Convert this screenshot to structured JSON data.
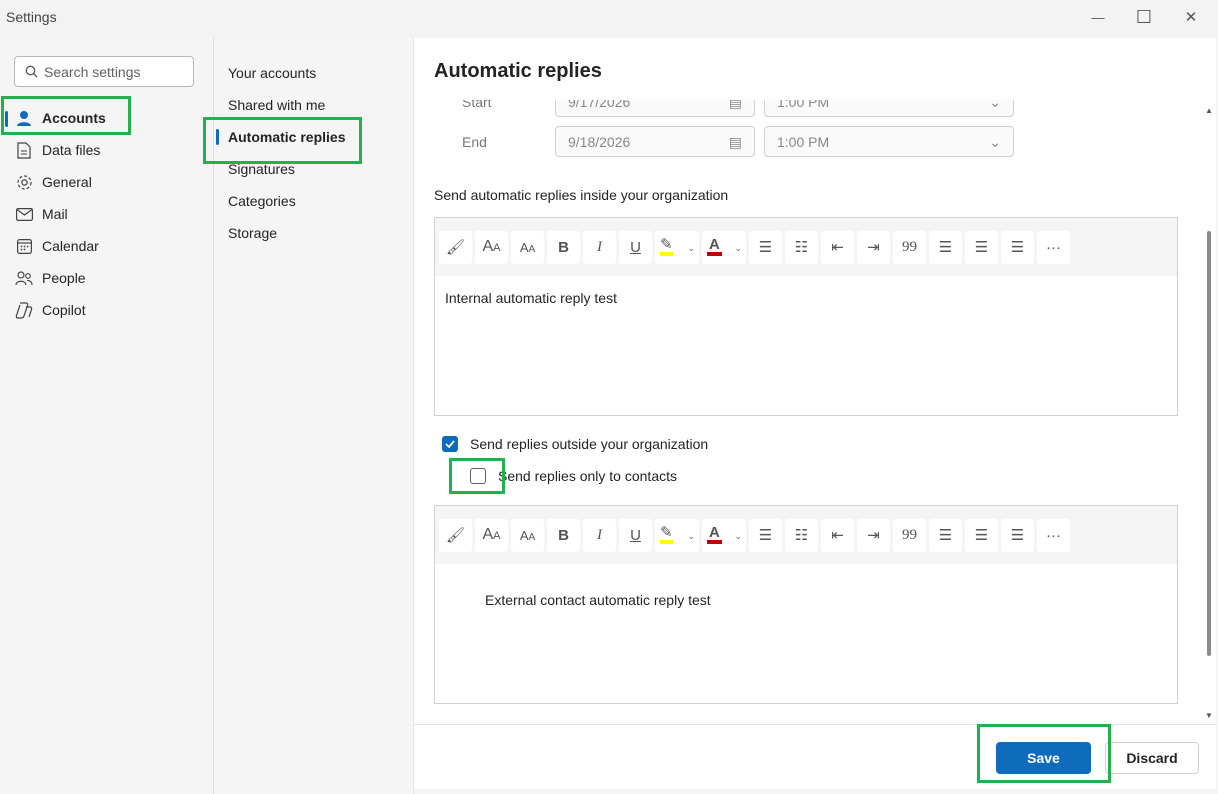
{
  "window": {
    "title": "Settings",
    "minimize_glyph": "—",
    "maximize_glyph": "☐",
    "close_glyph": "✕"
  },
  "search": {
    "placeholder": "Search settings"
  },
  "left_nav": {
    "items": [
      {
        "label": "Accounts",
        "icon": "person-icon",
        "active": true
      },
      {
        "label": "Data files",
        "icon": "document-icon"
      },
      {
        "label": "General",
        "icon": "gear-icon"
      },
      {
        "label": "Mail",
        "icon": "mail-icon"
      },
      {
        "label": "Calendar",
        "icon": "calendar-icon"
      },
      {
        "label": "People",
        "icon": "people-icon"
      },
      {
        "label": "Copilot",
        "icon": "copilot-icon"
      }
    ]
  },
  "sub_nav": {
    "items": [
      {
        "label": "Your accounts"
      },
      {
        "label": "Shared with me"
      },
      {
        "label": "Automatic replies",
        "active": true
      },
      {
        "label": "Signatures"
      },
      {
        "label": "Categories"
      },
      {
        "label": "Storage"
      }
    ]
  },
  "main": {
    "title": "Automatic replies",
    "start": {
      "label": "Start",
      "date": "9/17/2026",
      "time": "1:00 PM"
    },
    "end": {
      "label": "End",
      "date": "9/18/2026",
      "time": "1:00 PM"
    },
    "inside_label": "Send automatic replies inside your organization",
    "internal_message": "Internal automatic reply test",
    "outside": {
      "label": "Send replies outside your organization",
      "checked": true
    },
    "contacts_only": {
      "label": "Send replies only to contacts",
      "checked": false
    },
    "external_message": "External contact automatic reply test"
  },
  "toolbar_glyphs": {
    "bold": "B",
    "italic": "I",
    "underline": "U",
    "font_color": "A",
    "quote": "99",
    "more": "···"
  },
  "footer": {
    "save_label": "Save",
    "discard_label": "Discard"
  },
  "colors": {
    "accent": "#0f6cbd",
    "highlight_box": "#22b14c"
  }
}
